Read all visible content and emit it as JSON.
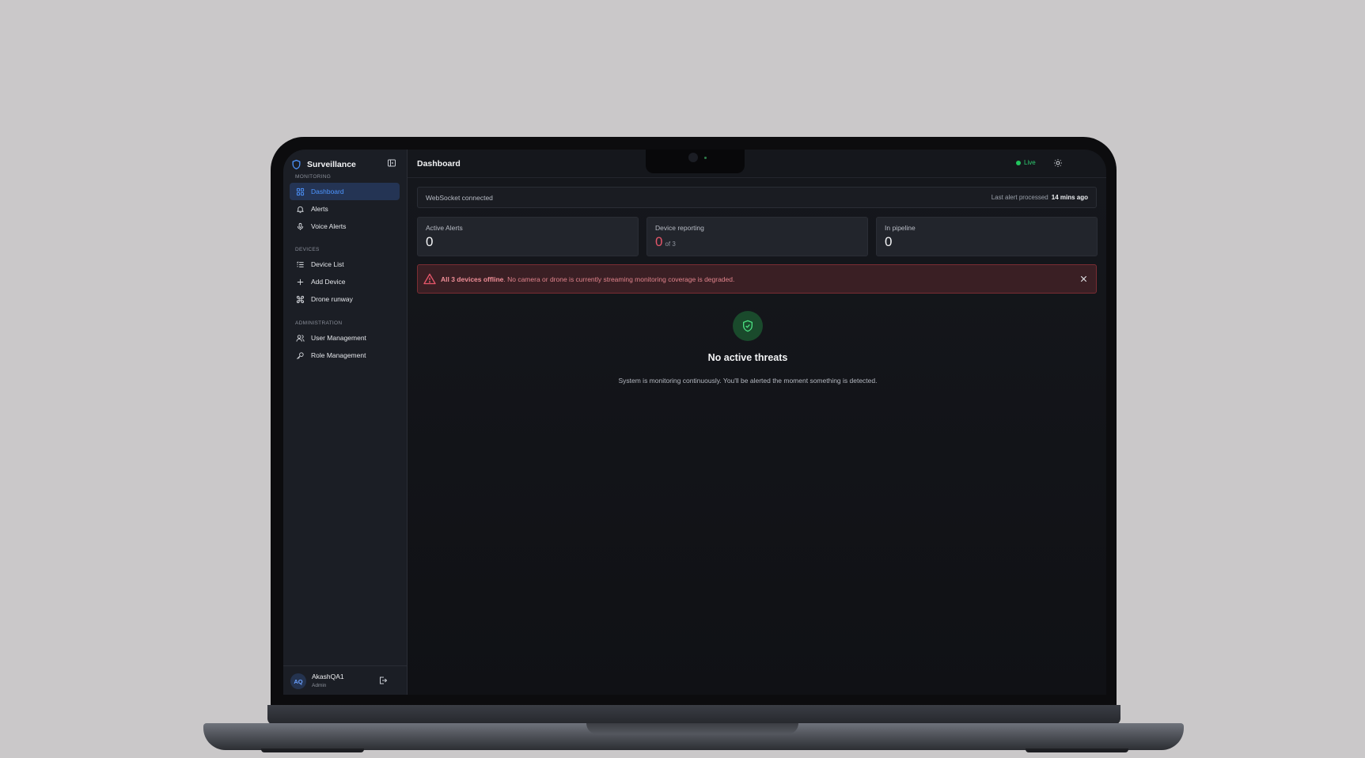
{
  "app": {
    "brand": "Surveillance"
  },
  "sidebar": {
    "sections": [
      {
        "title": "MONITORING",
        "items": [
          {
            "label": "Dashboard",
            "icon": "grid-icon",
            "active": true
          },
          {
            "label": "Alerts",
            "icon": "bell-icon"
          },
          {
            "label": "Voice Alerts",
            "icon": "microphone-icon"
          }
        ]
      },
      {
        "title": "DEVICES",
        "items": [
          {
            "label": "Device List",
            "icon": "list-icon"
          },
          {
            "label": "Add Device",
            "icon": "plus-icon"
          },
          {
            "label": "Drone runway",
            "icon": "drone-icon"
          }
        ]
      },
      {
        "title": "ADMINISTRATION",
        "items": [
          {
            "label": "User Management",
            "icon": "users-icon"
          },
          {
            "label": "Role Management",
            "icon": "key-icon"
          }
        ]
      }
    ],
    "user": {
      "initials": "AQ",
      "name": "AkashQA1",
      "role": "Admin"
    }
  },
  "header": {
    "title": "Dashboard",
    "status": "Live"
  },
  "connection": {
    "status": "WebSocket connected",
    "last_alert_label": "Last alert processed",
    "last_alert_value": "14 mins ago"
  },
  "stats": [
    {
      "label": "Active Alerts",
      "value": "0"
    },
    {
      "label": "Device reporting",
      "value": "0",
      "sub": "of 3"
    },
    {
      "label": "In pipeline",
      "value": "0"
    }
  ],
  "banner": {
    "bold": "All 3 devices offline",
    "text": ". No camera or drone is currently streaming monitoring coverage is degraded."
  },
  "empty_state": {
    "title": "No active threats",
    "subtitle": "System is monitoring continuously. You'll be alerted the moment something is detected."
  },
  "colors": {
    "accent": "#4d95ff",
    "live": "#22c55e",
    "danger": "#e5566a",
    "background": "#121317"
  }
}
